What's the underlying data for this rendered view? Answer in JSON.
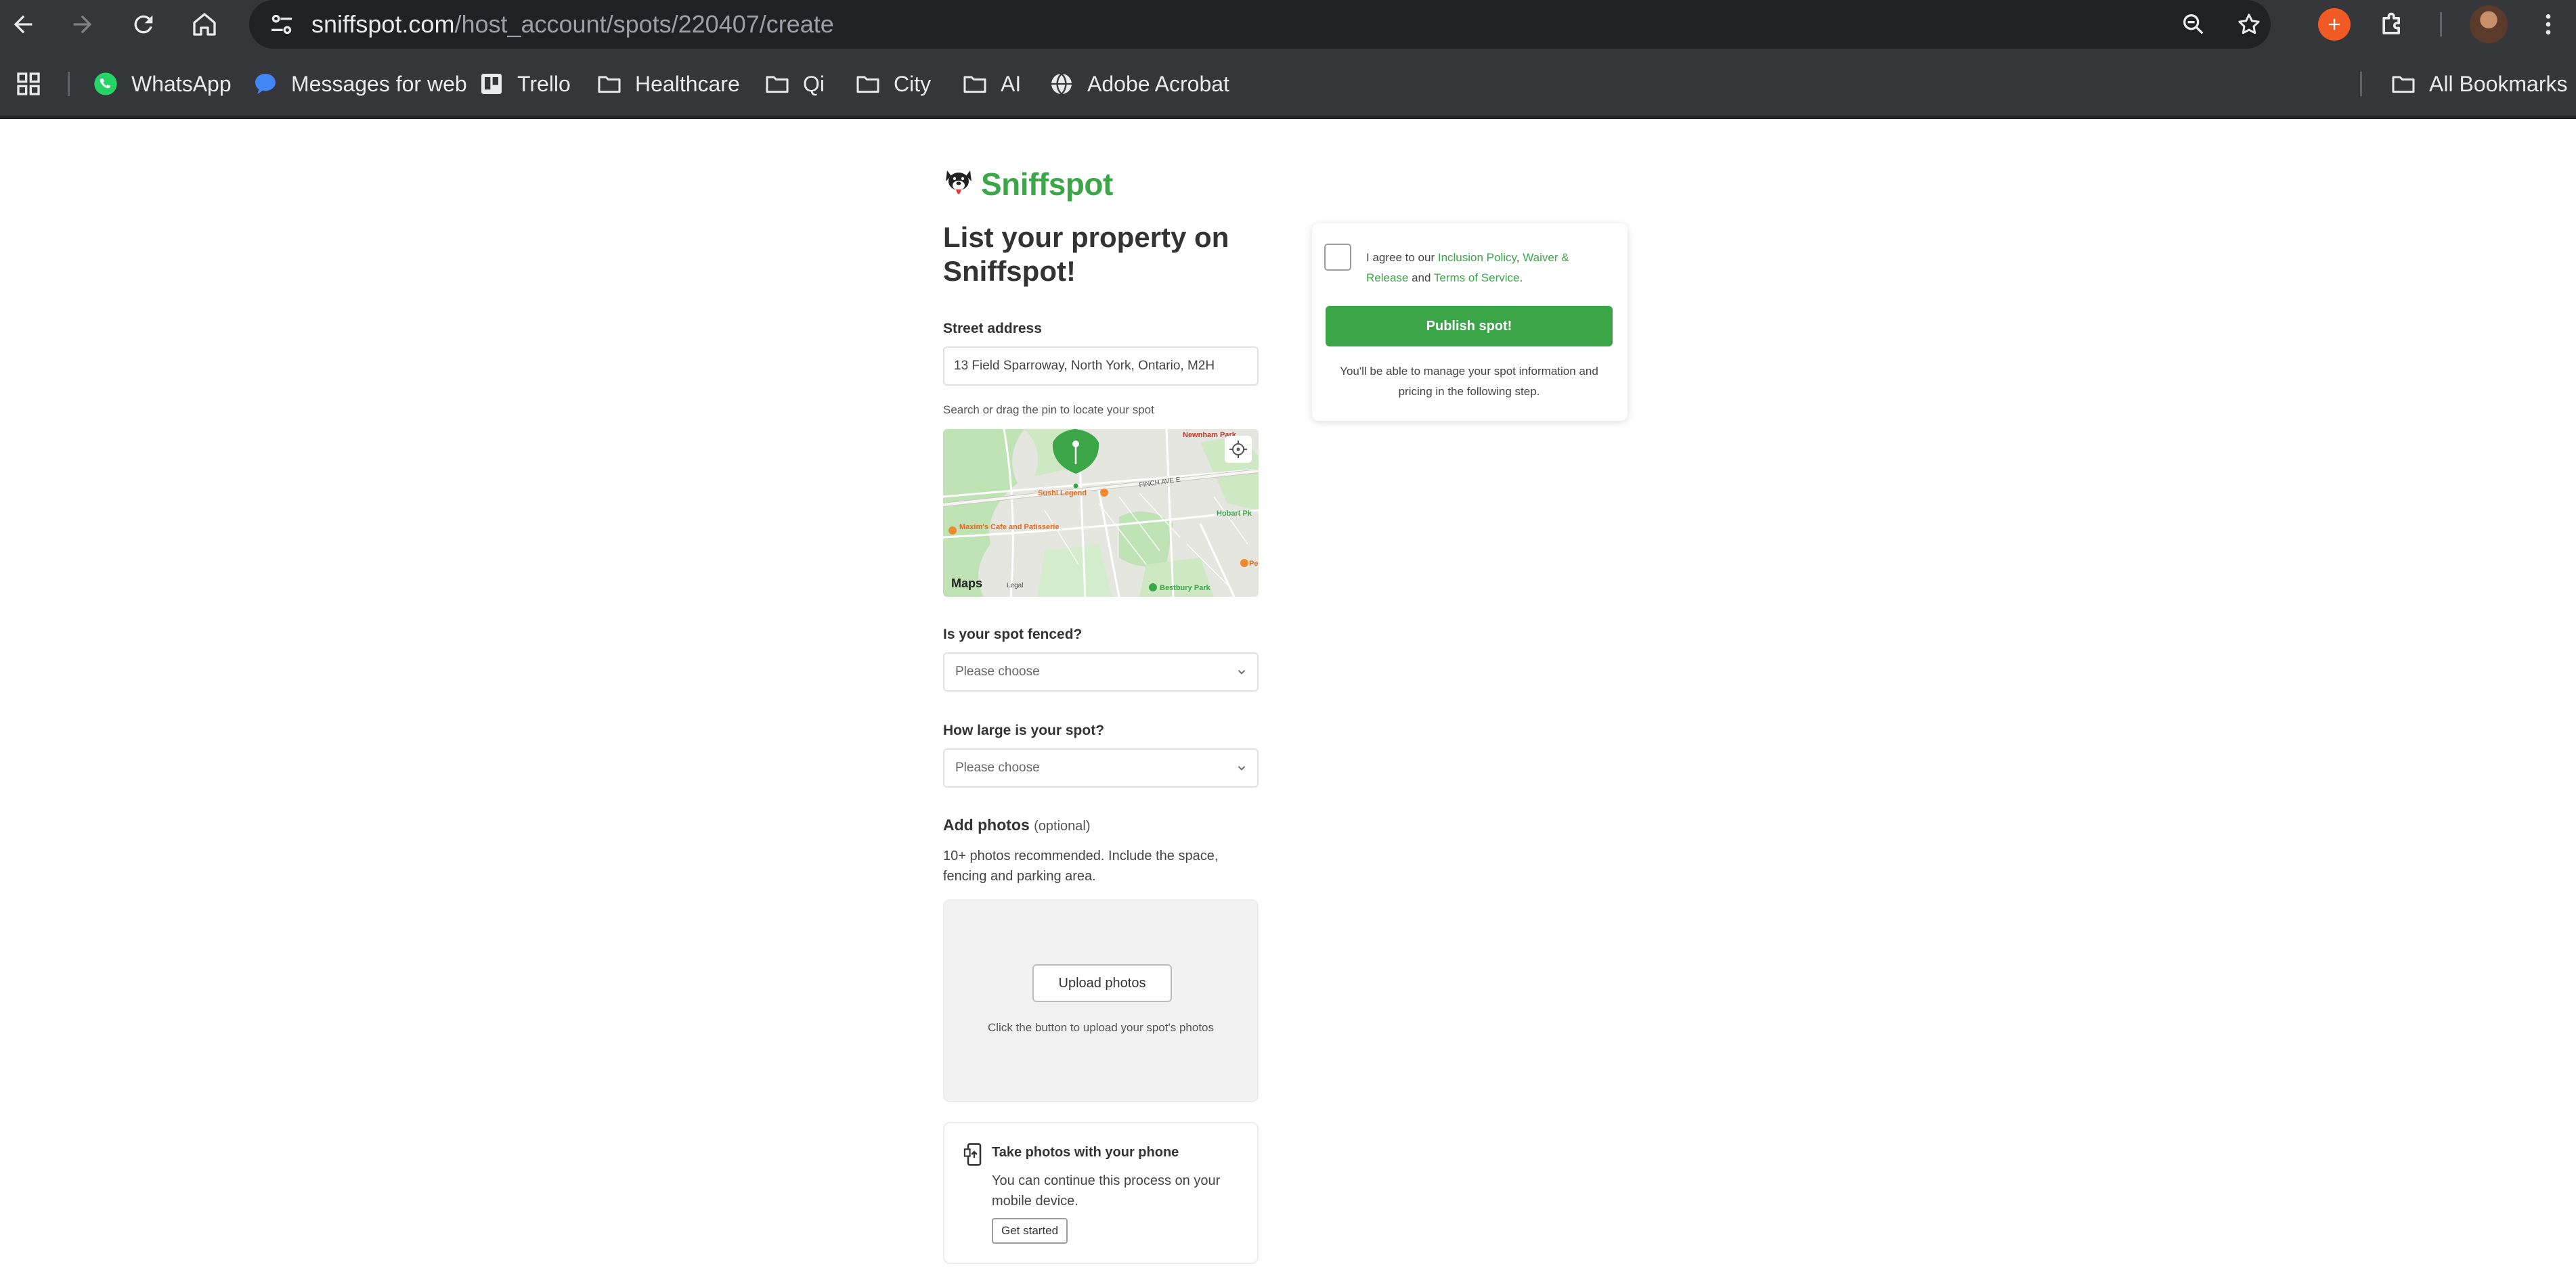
{
  "browser": {
    "url_host": "sniffspot.com",
    "url_path": "/host_account/spots/220407/create",
    "bookmarks": [
      {
        "label": "WhatsApp",
        "icon": "whatsapp-icon"
      },
      {
        "label": "Messages for web",
        "icon": "messages-icon"
      },
      {
        "label": "Trello",
        "icon": "trello-icon"
      },
      {
        "label": "Healthcare",
        "icon": "folder-icon"
      },
      {
        "label": "Qi",
        "icon": "folder-icon"
      },
      {
        "label": "City",
        "icon": "folder-icon"
      },
      {
        "label": "AI",
        "icon": "folder-icon"
      },
      {
        "label": "Adobe Acrobat",
        "icon": "globe-icon"
      }
    ],
    "all_bookmarks": "All Bookmarks"
  },
  "brand": {
    "name": "Sniffspot",
    "color": "#3aa648"
  },
  "form": {
    "title": "List your property on Sniffspot!",
    "street_label": "Street address",
    "street_value": "13 Field Sparroway, North York, Ontario, M2H",
    "map_helper": "Search or drag the pin to locate your spot",
    "map": {
      "labels": [
        "Sushi Legend",
        "FINCH AVE E",
        "Maxim's Cafe and Patisserie",
        "Newnham Park",
        "Hobart Pk",
        "Bestbury Park",
        "Pe"
      ],
      "attribution": "Maps",
      "legal": "Legal"
    },
    "fenced_label": "Is your spot fenced?",
    "fenced_placeholder": "Please choose",
    "size_label": "How large is your spot?",
    "size_placeholder": "Please choose",
    "photos_title": "Add photos",
    "photos_optional": "(optional)",
    "photos_desc": "10+ photos recommended. Include the space, fencing and parking area.",
    "upload_button": "Upload photos",
    "upload_help": "Click the button to upload your spot's photos",
    "phone_title": "Take photos with your phone",
    "phone_desc": "You can continue this process on your mobile device.",
    "phone_button": "Get started"
  },
  "agree": {
    "prefix": "I agree to our ",
    "link1": "Inclusion Policy",
    "sep1": ", ",
    "link2": "Waiver & Release",
    "sep2": " and ",
    "link3": "Terms of Service",
    "suffix": ".",
    "publish": "Publish spot!",
    "note": "You'll be able to manage your spot information and pricing in the following step."
  }
}
